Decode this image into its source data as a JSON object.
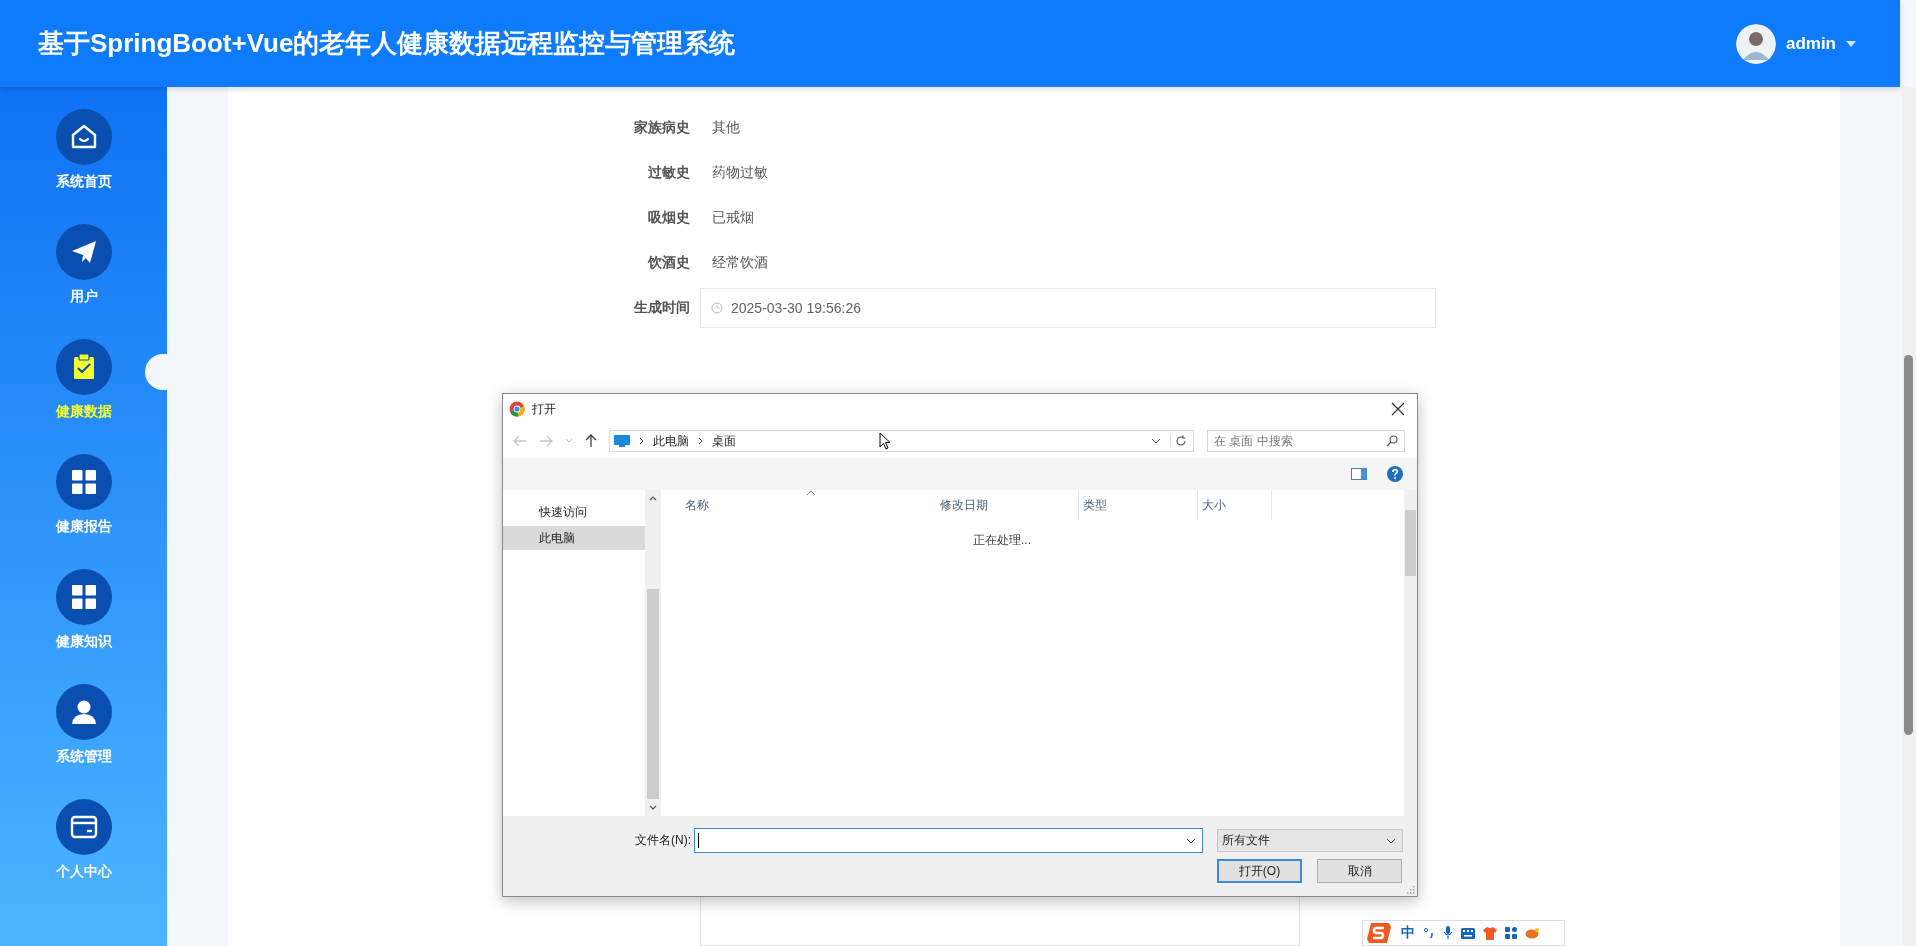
{
  "header": {
    "title": "基于SpringBoot+Vue的老年人健康数据远程监控与管理系统",
    "user": "admin"
  },
  "sidebar": {
    "items": [
      {
        "label": "系统首页",
        "kind": "home",
        "selected": false
      },
      {
        "label": "用户",
        "kind": "plane",
        "selected": false
      },
      {
        "label": "健康数据",
        "kind": "clipboard",
        "selected": true
      },
      {
        "label": "健康报告",
        "kind": "grid",
        "selected": false
      },
      {
        "label": "健康知识",
        "kind": "grid",
        "selected": false
      },
      {
        "label": "系统管理",
        "kind": "user",
        "selected": false
      },
      {
        "label": "个人中心",
        "kind": "card",
        "selected": false
      }
    ]
  },
  "form": {
    "fields": [
      {
        "label": "家族病史",
        "value": "其他",
        "kind": "text"
      },
      {
        "label": "过敏史",
        "value": "药物过敏",
        "kind": "text"
      },
      {
        "label": "吸烟史",
        "value": "已戒烟",
        "kind": "text"
      },
      {
        "label": "饮酒史",
        "value": "经常饮酒",
        "kind": "text"
      },
      {
        "label": "生成时间",
        "value": "2025-03-30 19:56:26",
        "kind": "date"
      }
    ]
  },
  "dialog": {
    "title": "打开",
    "breadcrumb": [
      "此电脑",
      "桌面"
    ],
    "search": {
      "placeholder": "在 桌面 中搜索"
    },
    "nav": [
      {
        "label": "快速访问",
        "selected": false
      },
      {
        "label": "此电脑",
        "selected": true
      }
    ],
    "columns": [
      "名称",
      "修改日期",
      "类型",
      "大小"
    ],
    "status": "正在处理...",
    "filename_label": "文件名(N):",
    "filter": "所有文件",
    "buttons": [
      {
        "label": "打开(O)",
        "kind": "primary"
      },
      {
        "label": "取消",
        "kind": "normal"
      }
    ]
  },
  "ime": {
    "mode": "中"
  }
}
